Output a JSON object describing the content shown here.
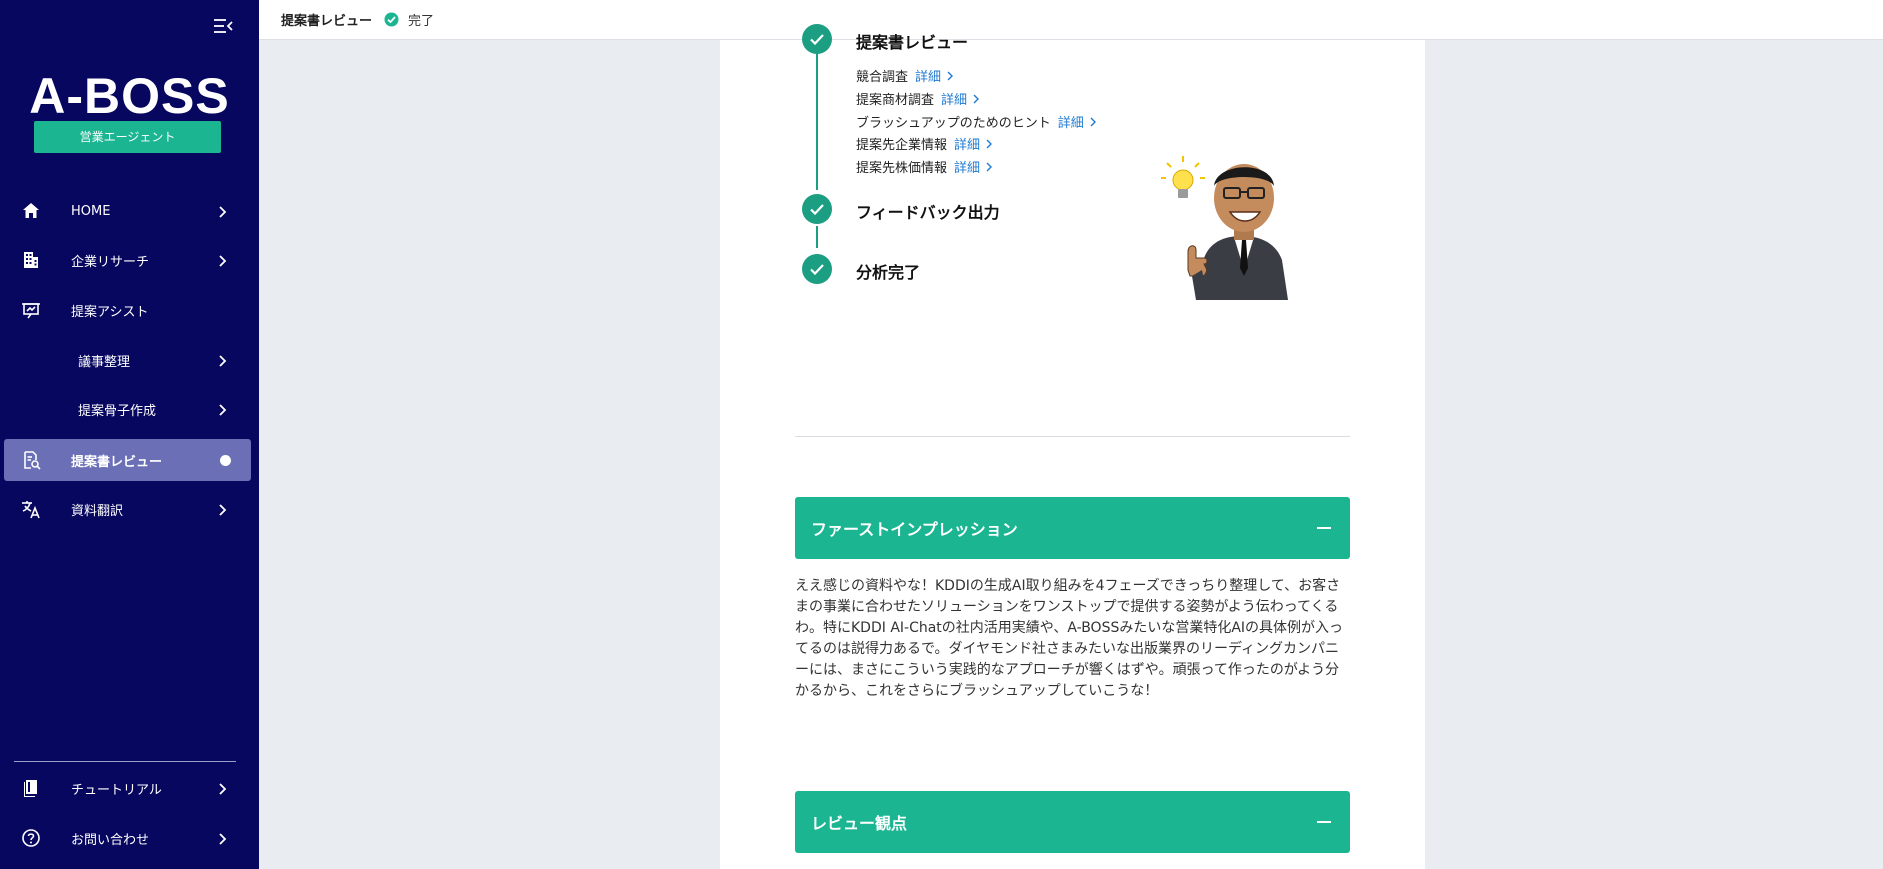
{
  "sidebar": {
    "logo": "A-BOSS",
    "badge": "営業エージェント",
    "items": [
      {
        "label": "HOME"
      },
      {
        "label": "企業リサーチ"
      },
      {
        "label": "提案アシスト"
      },
      {
        "label": "議事整理"
      },
      {
        "label": "提案骨子作成"
      },
      {
        "label": "提案書レビュー"
      },
      {
        "label": "資料翻訳"
      }
    ],
    "footer_items": [
      {
        "label": "チュートリアル"
      },
      {
        "label": "お問い合わせ"
      }
    ]
  },
  "topbar": {
    "title": "提案書レビュー",
    "status": "完了"
  },
  "timeline": {
    "steps": [
      {
        "title": "提案書レビュー"
      },
      {
        "title": "フィードバック出力"
      },
      {
        "title": "分析完了"
      }
    ],
    "sub_items": [
      {
        "label": "競合調査",
        "link": "詳細"
      },
      {
        "label": "提案商材調査",
        "link": "詳細"
      },
      {
        "label": "ブラッシュアップのためのヒント",
        "link": "詳細"
      },
      {
        "label": "提案先企業情報",
        "link": "詳細"
      },
      {
        "label": "提案先株価情報",
        "link": "詳細"
      }
    ]
  },
  "sections": {
    "first_impression": {
      "title": "ファーストインプレッション",
      "body": "ええ感じの資料やな！KDDIの生成AI取り組みを4フェーズできっちり整理して、お客さまの事業に合わせたソリューションをワンストップで提供する姿勢がよう伝わってくるわ。特にKDDI AI-Chatの社内活用実績や、A-BOSSみたいな営業特化AIの具体例が入ってるのは説得力あるで。ダイヤモンド社さまみたいな出版業界のリーディングカンパニーには、まさにこういう実践的なアプローチが響くはずや。頑張って作ったのがよう分かるから、これをさらにブラッシュアップしていこうな！"
    },
    "review_points": {
      "title": "レビュー観点"
    }
  },
  "colors": {
    "sidebar_bg": "#070760",
    "accent": "#1bb592",
    "active_item": "#6a6fb6",
    "link": "#1f7ad1"
  }
}
